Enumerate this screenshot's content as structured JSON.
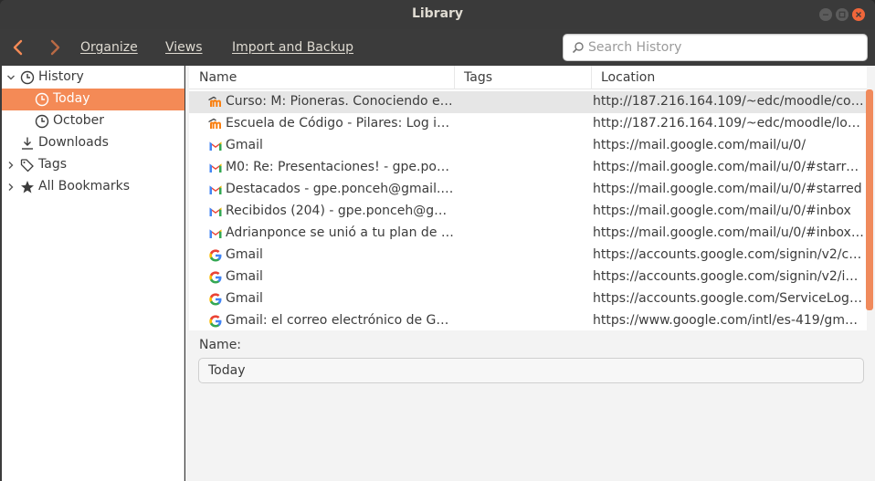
{
  "window": {
    "title": "Library"
  },
  "toolbar": {
    "organize": "Organize",
    "views": "Views",
    "import": "Import and Backup",
    "search_placeholder": "Search History"
  },
  "sidebar": {
    "items": [
      {
        "label": "History",
        "icon": "clock-icon"
      },
      {
        "label": "Today",
        "icon": "clock-icon"
      },
      {
        "label": "October",
        "icon": "clock-icon"
      },
      {
        "label": "Downloads",
        "icon": "download-icon"
      },
      {
        "label": "Tags",
        "icon": "tag-icon"
      },
      {
        "label": "All Bookmarks",
        "icon": "star-icon"
      }
    ]
  },
  "table": {
    "columns": [
      "Name",
      "Tags",
      "Location"
    ],
    "rows": [
      {
        "icon": "moodle-icon",
        "name": "Curso: M: Pioneras. Conociendo el ...",
        "location": "http://187.216.164.109/~edc/moodle/cour..."
      },
      {
        "icon": "moodle-icon",
        "name": "Escuela de Código - Pilares: Log in ...",
        "location": "http://187.216.164.109/~edc/moodle/login..."
      },
      {
        "icon": "gmail-icon",
        "name": "Gmail",
        "location": "https://mail.google.com/mail/u/0/"
      },
      {
        "icon": "gmail-icon",
        "name": "M0: Re: Presentaciones! - gpe.ponc...",
        "location": "https://mail.google.com/mail/u/0/#starre..."
      },
      {
        "icon": "gmail-icon",
        "name": "Destacados - gpe.ponceh@gmail.c...",
        "location": "https://mail.google.com/mail/u/0/#starred"
      },
      {
        "icon": "gmail-icon",
        "name": "Recibidos (204) - gpe.ponceh@gm...",
        "location": "https://mail.google.com/mail/u/0/#inbox"
      },
      {
        "icon": "gmail-icon",
        "name": "Adrianponce se unió a tu plan de S...",
        "location": "https://mail.google.com/mail/u/0/#inbox/..."
      },
      {
        "icon": "google-icon",
        "name": "Gmail",
        "location": "https://accounts.google.com/signin/v2/ch..."
      },
      {
        "icon": "google-icon",
        "name": "Gmail",
        "location": "https://accounts.google.com/signin/v2/ide..."
      },
      {
        "icon": "google-icon",
        "name": "Gmail",
        "location": "https://accounts.google.com/ServiceLogin..."
      },
      {
        "icon": "google-icon",
        "name": "Gmail: el correo electrónico de Go...",
        "location": "https://www.google.com/intl/es-419/gmail..."
      }
    ]
  },
  "details": {
    "name_label": "Name:",
    "name_value": "Today"
  },
  "colors": {
    "accent": "#f48a56",
    "titlebar": "#3a3a3a",
    "close": "#f0663a"
  }
}
